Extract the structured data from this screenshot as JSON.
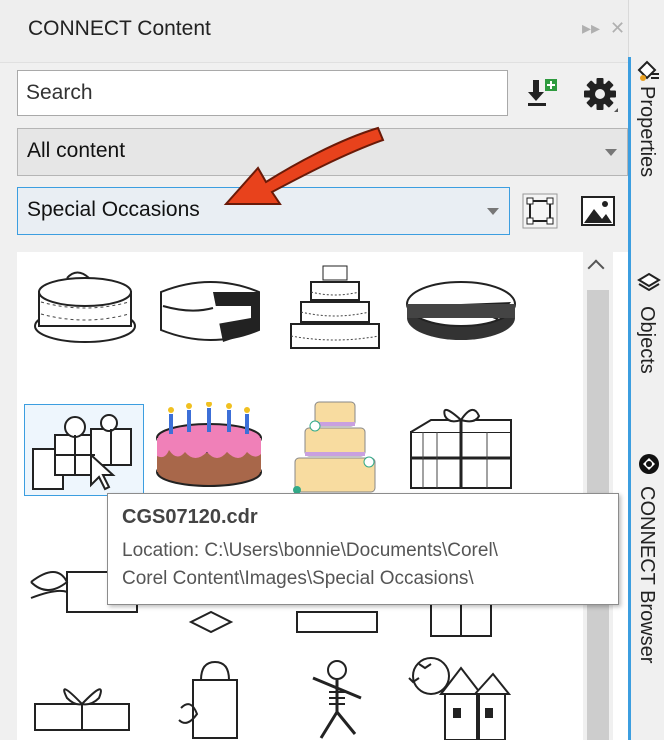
{
  "header": {
    "title": "CONNECT Content"
  },
  "toolbar": {
    "search_placeholder": "Search"
  },
  "content_filter": {
    "selected": "All content"
  },
  "folder_select": {
    "selected": "Special Occasions"
  },
  "thumbnails": [
    {
      "kind": "cake-line-art"
    },
    {
      "kind": "sliced-cake"
    },
    {
      "kind": "tiered-cake"
    },
    {
      "kind": "cheese-wheel"
    },
    {
      "kind": "gift-pile",
      "selected": true
    },
    {
      "kind": "pink-birthday-cake"
    },
    {
      "kind": "yellow-wedding-cake"
    },
    {
      "kind": "gift-box"
    },
    {
      "kind": "ribbon-gift"
    },
    {
      "kind": "gift-box-2"
    },
    {
      "kind": "gift-box-3"
    },
    {
      "kind": "gift-box-4"
    },
    {
      "kind": "flat-gift"
    },
    {
      "kind": "shopping-bag"
    },
    {
      "kind": "dancing-skeleton"
    },
    {
      "kind": "haunted-house"
    }
  ],
  "tooltip": {
    "filename": "CGS07120.cdr",
    "location_line1": "Location: C:\\Users\\bonnie\\Documents\\Corel\\",
    "location_line2": "Corel Content\\Images\\Special Occasions\\"
  },
  "side_tabs": {
    "properties": "Properties",
    "objects": "Objects",
    "connect_browser": "CONNECT Browser"
  },
  "colors": {
    "accent": "#3c9ee0",
    "annotation_arrow": "#e8421c",
    "cake_pink": "#f080b8",
    "cake_brown": "#a8674a",
    "wedding_cake": "#f8dca0"
  }
}
